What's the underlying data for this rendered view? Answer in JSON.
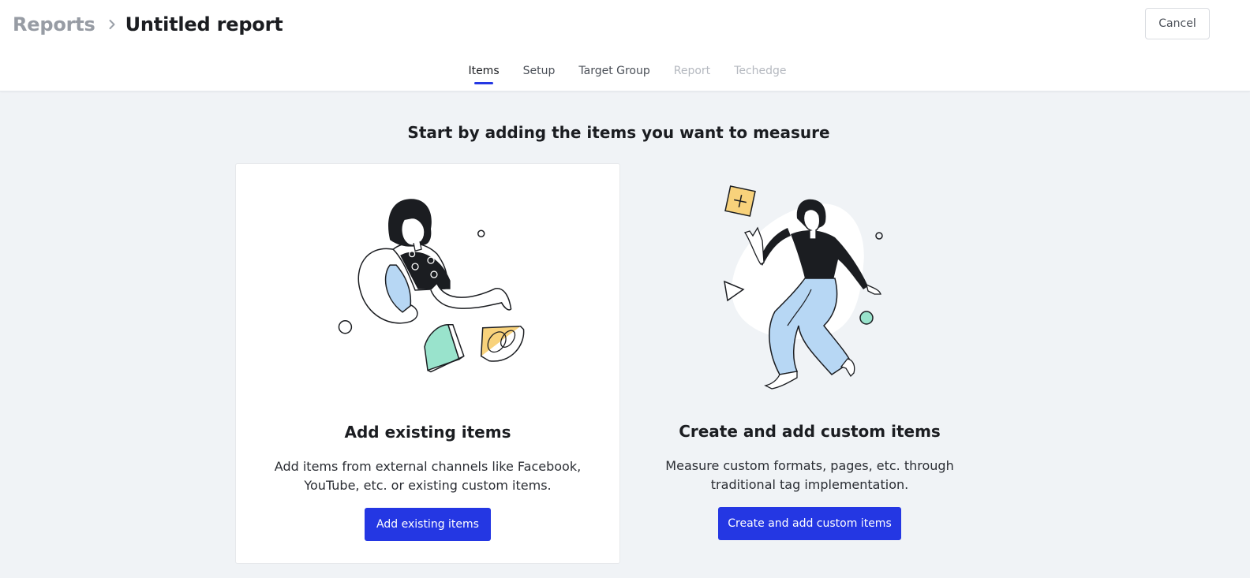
{
  "breadcrumb": {
    "parent": "Reports",
    "current": "Untitled report",
    "separator_icon": "chevron-right-icon"
  },
  "header": {
    "cancel_label": "Cancel"
  },
  "tabs": [
    {
      "label": "Items",
      "state": "active"
    },
    {
      "label": "Setup",
      "state": "enabled"
    },
    {
      "label": "Target Group",
      "state": "enabled"
    },
    {
      "label": "Report",
      "state": "disabled"
    },
    {
      "label": "Techedge",
      "state": "disabled"
    }
  ],
  "main": {
    "headline": "Start by adding the items you want to measure",
    "cards": [
      {
        "title": "Add existing items",
        "description": "Add items from external channels like Facebook, YouTube, etc. or existing custom items.",
        "button_label": "Add existing items",
        "illustration": "woman-with-pie-slices-illustration"
      },
      {
        "title": "Create and add custom items",
        "description": "Measure custom formats, pages, etc. through traditional tag implementation.",
        "button_label": "Create and add custom items",
        "illustration": "woman-floating-with-shapes-illustration"
      }
    ]
  },
  "colors": {
    "accent": "#2437e3",
    "background": "#f0f3f6",
    "illustration_blue": "#b7d7f4",
    "illustration_mint": "#99e3cc",
    "illustration_yellow": "#f8d27b"
  }
}
